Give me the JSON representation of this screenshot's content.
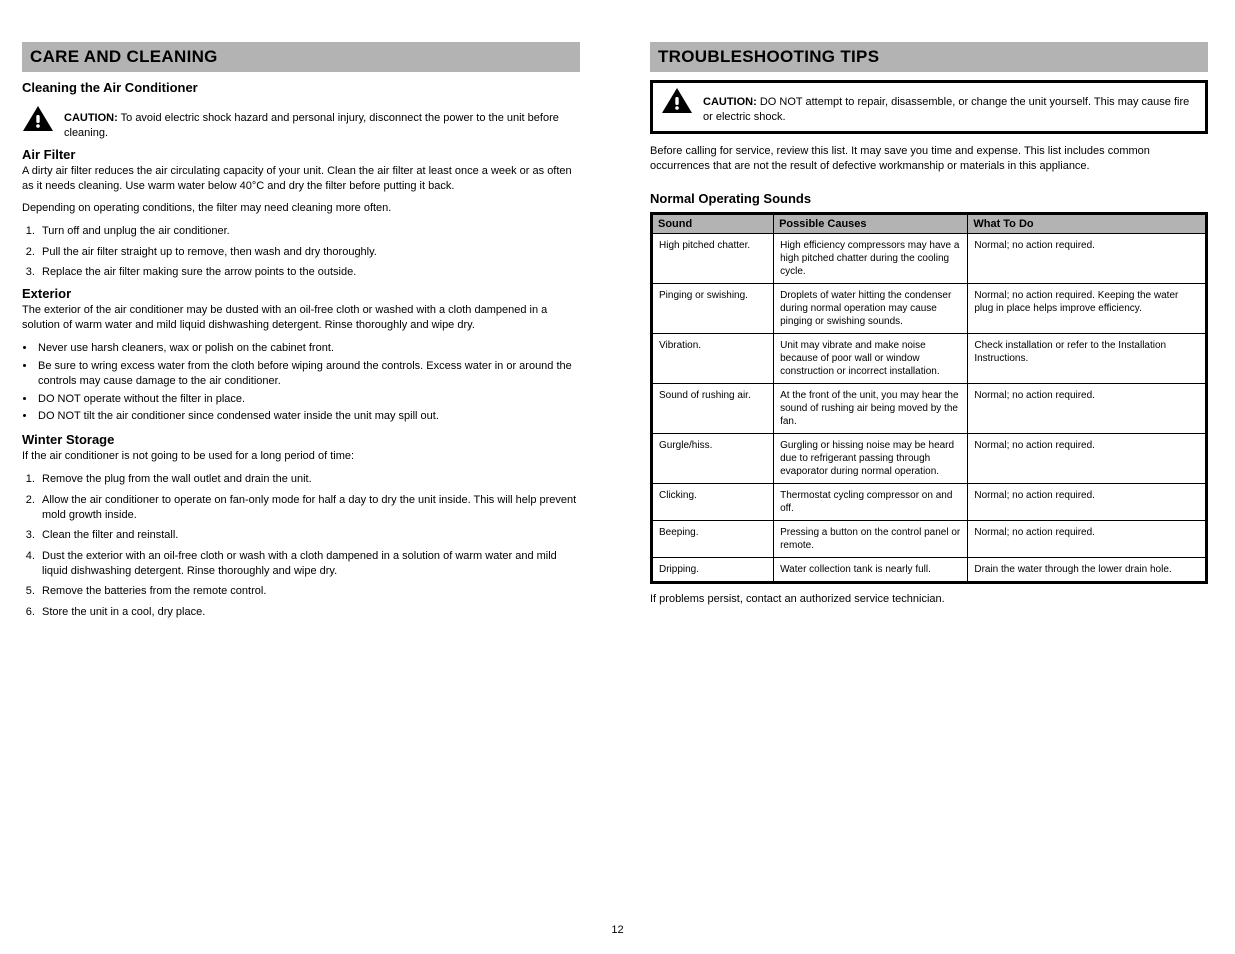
{
  "left": {
    "banner": "CARE AND CLEANING",
    "intro_heading": "Cleaning the Air Conditioner",
    "caution_label": "CAUTION:",
    "caution_text": "To avoid electric shock hazard and personal injury, disconnect the power to the unit before cleaning.",
    "filter_heading": "Air Filter",
    "filter_p1": "A dirty air filter reduces the air circulating capacity of your unit. Clean the air filter at least once a week or as often as it needs cleaning. Use warm water below 40°C and dry the filter before putting it back.",
    "filter_p2": "Depending on operating conditions, the filter may need cleaning more often.",
    "steps": [
      "Turn off and unplug the air conditioner.",
      "Pull the air filter straight up to remove, then wash and dry thoroughly.",
      "Replace the air filter making sure the arrow points to the outside."
    ],
    "exterior_heading": "Exterior",
    "exterior_p": "The exterior of the air conditioner may be dusted with an oil-free cloth or washed with a cloth dampened in a solution of warm water and mild liquid dishwashing detergent. Rinse thoroughly and wipe dry.",
    "exterior_bullets": [
      "Never use harsh cleaners, wax or polish on the cabinet front.",
      "Be sure to wring excess water from the cloth before wiping around the controls. Excess water in or around the controls may cause damage to the air conditioner.",
      "DO NOT operate without the filter in place.",
      "DO NOT tilt the air conditioner since condensed water inside the unit may spill out."
    ],
    "storage_heading": "Winter Storage",
    "storage_p": "If the air conditioner is not going to be used for a long period of time:",
    "storage_steps": [
      "Remove the plug from the wall outlet and drain the unit.",
      "Allow the air conditioner to operate on fan-only mode for half a day to dry the unit inside. This will help prevent mold growth inside.",
      "Clean the filter and reinstall.",
      "Dust the exterior with an oil-free cloth or wash with a cloth dampened in a solution of warm water and mild liquid dishwashing detergent. Rinse thoroughly and wipe dry.",
      "Remove the batteries from the remote control.",
      "Store the unit in a cool, dry place."
    ]
  },
  "right": {
    "banner": "TROUBLESHOOTING TIPS",
    "caution_label": "CAUTION:",
    "caution_text": "DO NOT attempt to repair, disassemble, or change the unit yourself. This may cause fire or electric shock.",
    "intro": "Before calling for service, review this list. It may save you time and expense. This list includes common occurrences that are not the result of defective workmanship or materials in this appliance.",
    "tbl_title": "Normal Operating Sounds",
    "headers": [
      "Sound",
      "Possible Causes",
      "What To Do"
    ],
    "rows": [
      {
        "c1": "High pitched chatter.",
        "c2": "High efficiency compressors may have a high pitched chatter during the cooling cycle.",
        "c3": "Normal; no action required."
      },
      {
        "c1": "Pinging or swishing.",
        "c2": "Droplets of water hitting the condenser during normal operation may cause pinging or swishing sounds.",
        "c3": "Normal; no action required. Keeping the water plug in place helps improve efficiency."
      },
      {
        "c1": "Vibration.",
        "c2": "Unit may vibrate and make noise because of poor wall or window construction or incorrect installation.",
        "c3": "Check installation or refer to the Installation Instructions."
      },
      {
        "c1": "Sound of rushing air.",
        "c2": "At the front of the unit, you may hear the sound of rushing air being moved by the fan.",
        "c3": "Normal; no action required."
      },
      {
        "c1": "Gurgle/hiss.",
        "c2": "Gurgling or hissing noise may be heard due to refrigerant passing through evaporator during normal operation.",
        "c3": "Normal; no action required."
      },
      {
        "c1": "Clicking.",
        "c2": "Thermostat cycling compressor on and off.",
        "c3": "Normal; no action required."
      },
      {
        "c1": "Beeping.",
        "c2": "Pressing a button on the control panel or remote.",
        "c3": "Normal; no action required."
      },
      {
        "c1": "Dripping.",
        "c2": "Water collection tank is nearly full.",
        "c3": "Drain the water through the lower drain hole."
      }
    ],
    "note": "If problems persist, contact an authorized service technician."
  },
  "page_number": "12"
}
